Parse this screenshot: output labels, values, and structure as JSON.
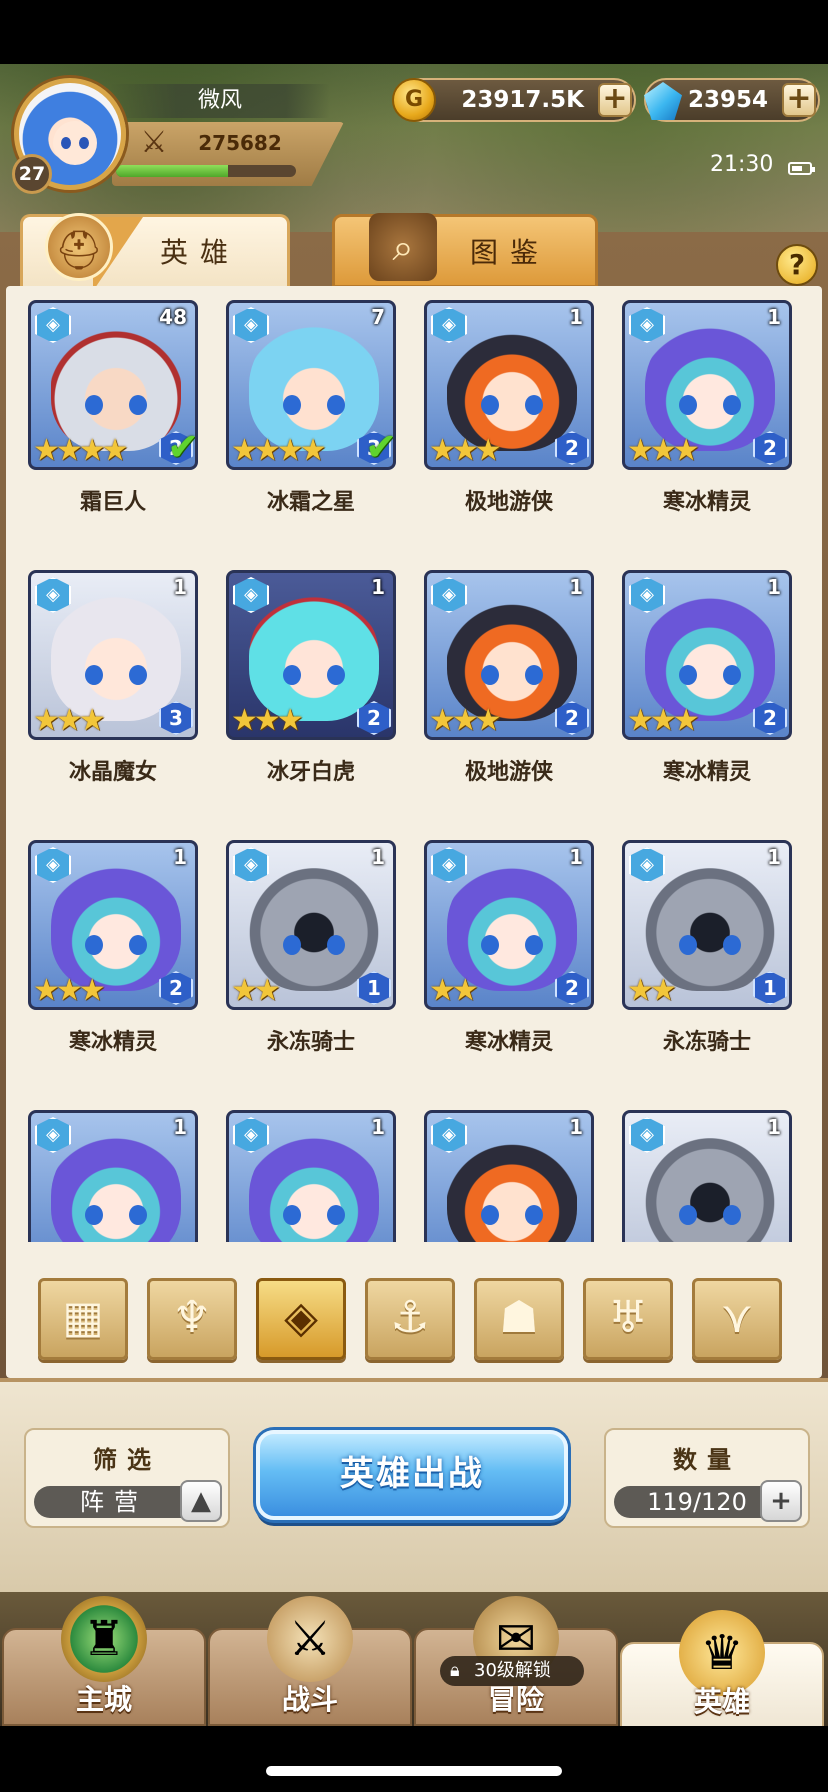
{
  "player": {
    "name": "微风",
    "level": "27",
    "power": "275682",
    "exp_progress": 0.62
  },
  "currency": {
    "gold": "23917.5K",
    "gems": "23954",
    "gold_icon": "G"
  },
  "status": {
    "time": "21:30"
  },
  "tabs": [
    {
      "label": "英雄",
      "icon": "helmet-icon",
      "active": true
    },
    {
      "label": "图鉴",
      "icon": "magnifier-icon",
      "active": false
    }
  ],
  "help_label": "?",
  "heroes": [
    {
      "name": "霜巨人",
      "level": "48",
      "stars": "★★★★",
      "rank": "2",
      "faction": "◈",
      "deployed": true
    },
    {
      "name": "冰霜之星",
      "level": "7",
      "stars": "★★★★",
      "rank": "3",
      "faction": "◈",
      "deployed": true
    },
    {
      "name": "极地游侠",
      "level": "1",
      "stars": "★★★",
      "rank": "2",
      "faction": "◈",
      "deployed": false
    },
    {
      "name": "寒冰精灵",
      "level": "1",
      "stars": "★★★",
      "rank": "2",
      "faction": "◈",
      "deployed": false
    },
    {
      "name": "冰晶魔女",
      "level": "1",
      "stars": "★★★",
      "rank": "3",
      "faction": "◈",
      "deployed": false
    },
    {
      "name": "冰牙白虎",
      "level": "1",
      "stars": "★★★",
      "rank": "2",
      "faction": "◈",
      "deployed": false
    },
    {
      "name": "极地游侠",
      "level": "1",
      "stars": "★★★",
      "rank": "2",
      "faction": "◈",
      "deployed": false
    },
    {
      "name": "寒冰精灵",
      "level": "1",
      "stars": "★★★",
      "rank": "2",
      "faction": "◈",
      "deployed": false
    },
    {
      "name": "寒冰精灵",
      "level": "1",
      "stars": "★★★",
      "rank": "2",
      "faction": "◈",
      "deployed": false
    },
    {
      "name": "永冻骑士",
      "level": "1",
      "stars": "★★",
      "rank": "1",
      "faction": "◈",
      "deployed": false
    },
    {
      "name": "寒冰精灵",
      "level": "1",
      "stars": "★★",
      "rank": "2",
      "faction": "◈",
      "deployed": false
    },
    {
      "name": "永冻骑士",
      "level": "1",
      "stars": "★★",
      "rank": "1",
      "faction": "◈",
      "deployed": false
    },
    {
      "name": "",
      "level": "1",
      "stars": "",
      "rank": "",
      "faction": "◈",
      "deployed": false
    },
    {
      "name": "",
      "level": "1",
      "stars": "",
      "rank": "",
      "faction": "◈",
      "deployed": false
    },
    {
      "name": "",
      "level": "1",
      "stars": "",
      "rank": "",
      "faction": "◈",
      "deployed": false
    },
    {
      "name": "",
      "level": "1",
      "stars": "",
      "rank": "",
      "faction": "◈",
      "deployed": false
    }
  ],
  "check_glyph": "✔",
  "faction_filters": [
    {
      "icon": "all-grid-icon",
      "glyph": "▦",
      "active": false
    },
    {
      "icon": "forest-icon",
      "glyph": "♆",
      "active": false
    },
    {
      "icon": "ice-crystal-icon",
      "glyph": "◈",
      "active": true
    },
    {
      "icon": "anchor-icon",
      "glyph": "⚓",
      "active": false
    },
    {
      "icon": "beast-icon",
      "glyph": "☗",
      "active": false
    },
    {
      "icon": "demon-horns-icon",
      "glyph": "♅",
      "active": false
    },
    {
      "icon": "wings-icon",
      "glyph": "⋎",
      "active": false
    }
  ],
  "filter_box": {
    "title": "筛选",
    "value": "阵营",
    "button_glyph": "▲"
  },
  "deploy_button": "英雄出战",
  "count_box": {
    "title": "数量",
    "value": "119/120",
    "button_glyph": "+"
  },
  "nav": [
    {
      "label": "主城",
      "icon": "castle-icon",
      "glyph": "♜",
      "active": false
    },
    {
      "label": "战斗",
      "icon": "crossed-swords-icon",
      "glyph": "⚔",
      "active": false
    },
    {
      "label": "冒险",
      "icon": "map-scroll-icon",
      "glyph": "✉",
      "active": false
    },
    {
      "label": "英雄",
      "icon": "hero-crest-icon",
      "glyph": "♛",
      "active": true
    }
  ],
  "lock_text": "30级解锁"
}
